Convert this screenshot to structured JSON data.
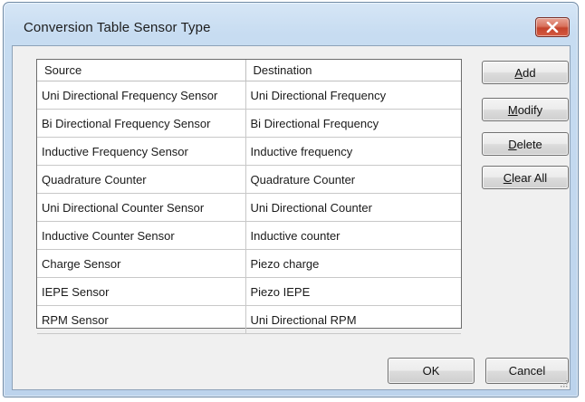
{
  "window": {
    "title": "Conversion Table Sensor Type"
  },
  "table": {
    "headers": [
      "Source",
      "Destination"
    ],
    "rows": [
      {
        "source": "Uni Directional Frequency Sensor",
        "destination": "Uni Directional Frequency"
      },
      {
        "source": "Bi Directional Frequency Sensor",
        "destination": "Bi Directional Frequency"
      },
      {
        "source": "Inductive Frequency Sensor",
        "destination": "Inductive frequency"
      },
      {
        "source": "Quadrature Counter",
        "destination": "Quadrature Counter"
      },
      {
        "source": "Uni Directional Counter Sensor",
        "destination": "Uni Directional Counter"
      },
      {
        "source": "Inductive Counter Sensor",
        "destination": "Inductive counter"
      },
      {
        "source": "Charge Sensor",
        "destination": "Piezo charge"
      },
      {
        "source": "IEPE Sensor",
        "destination": "Piezo IEPE"
      },
      {
        "source": "RPM Sensor",
        "destination": "Uni Directional RPM"
      }
    ]
  },
  "buttons": {
    "add": {
      "accel": "A",
      "rest": "dd"
    },
    "modify": {
      "accel": "M",
      "rest": "odify"
    },
    "delete": {
      "accel": "D",
      "rest": "elete"
    },
    "clear_all": {
      "accel": "C",
      "rest": "lear All"
    },
    "ok": "OK",
    "cancel": "Cancel"
  },
  "colors": {
    "close_button": "#d05a42",
    "window_frame": "#bcd3ec",
    "client_bg": "#f0f0f0"
  },
  "icons": {
    "close": "close-icon",
    "resize": "resize-grip-icon"
  }
}
